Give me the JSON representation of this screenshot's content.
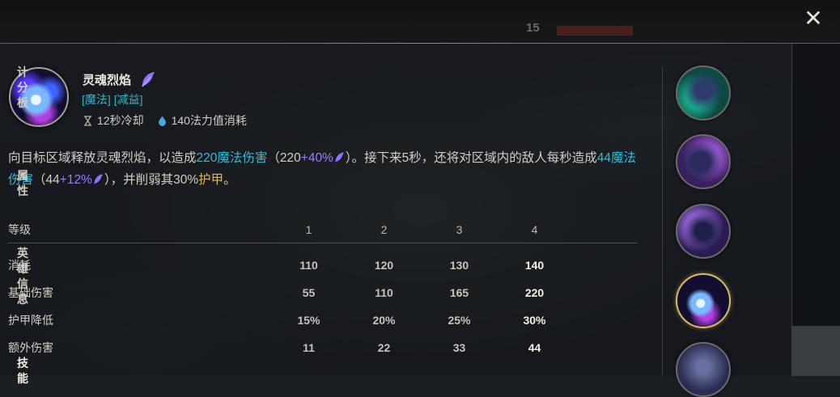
{
  "top": {
    "close_symbol": "✕"
  },
  "ability": {
    "name": "灵魂烈焰",
    "icon": "soul-flame-icon",
    "tags": [
      "[魔法]",
      "[减益]"
    ],
    "cooldown": "12秒冷却",
    "cost": "140法力值消耗"
  },
  "description": {
    "p1": "向目标区域释放灵魂烈焰，以造成",
    "dmg1": "220魔法伤害",
    "p2": "（220",
    "ap1": "+40%",
    "p3": "）。接下来5秒，还将对区域内的敌人每秒造成",
    "dmg2": "44魔法伤害",
    "p4": "（44",
    "ap2": "+12%",
    "p5": "），并削弱其30%",
    "armor": "护甲",
    "p6": "。"
  },
  "table": {
    "header_label": "等级",
    "levels": [
      "1",
      "2",
      "3",
      "4"
    ],
    "rows": [
      {
        "label": "消耗",
        "values": [
          "110",
          "120",
          "130",
          "140"
        ]
      },
      {
        "label": "基础伤害",
        "values": [
          "55",
          "110",
          "165",
          "220"
        ]
      },
      {
        "label": "护甲降低",
        "values": [
          "15%",
          "20%",
          "25%",
          "30%"
        ]
      },
      {
        "label": "额外伤害",
        "values": [
          "11",
          "22",
          "33",
          "44"
        ]
      }
    ]
  },
  "skills": [
    "passive-skill-icon",
    "skill-q-icon",
    "skill-w-icon",
    "skill-e-icon",
    "skill-r-icon"
  ],
  "tabs": [
    {
      "label": "计分板"
    },
    {
      "label": "属性"
    },
    {
      "label": "英雄信息"
    },
    {
      "label": "技能"
    }
  ],
  "colors": {
    "magic": "#3ab9d4",
    "ability_power": "#9a7cff",
    "armor": "#e2b54a",
    "gold": "#d9b86a"
  }
}
